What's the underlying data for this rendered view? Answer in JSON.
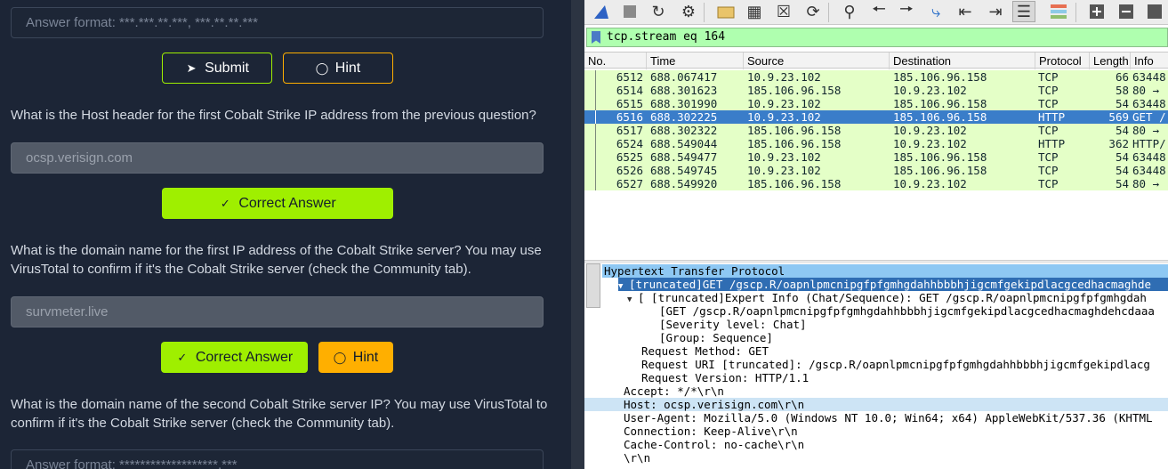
{
  "quiz": {
    "q0_placeholder": "Answer format: ***.***.**.***, ***.**.**.***",
    "submit_label": "Submit",
    "hint_label": "Hint",
    "q1_text": "What is the Host header for the first Cobalt Strike IP address from the previous question?",
    "q1_answer": "ocsp.verisign.com",
    "correct_label": "Correct Answer",
    "q2_text": "What is the domain name for the first IP address of the Cobalt Strike server? You may use VirusTotal to confirm if it's the Cobalt Strike server (check the Community tab).",
    "q2_answer": "survmeter.live",
    "q3_text": "What is the domain name of the second Cobalt Strike server IP?  You may use VirusTotal to confirm if it's the Cobalt Strike server (check the Community tab).",
    "q3_placeholder": "Answer format: *******************.***",
    "colors": {
      "accent_green": "#9fef00",
      "accent_orange": "#ffaf00",
      "background": "#1c2536"
    }
  },
  "wireshark": {
    "display_filter": "tcp.stream eq 164",
    "columns": [
      "No.",
      "Time",
      "Source",
      "Destination",
      "Protocol",
      "Length",
      "Info"
    ],
    "packets": [
      {
        "no": "6512",
        "time": "688.067417",
        "src": "10.9.23.102",
        "dst": "185.106.96.158",
        "proto": "TCP",
        "len": "66",
        "info": "63448"
      },
      {
        "no": "6514",
        "time": "688.301623",
        "src": "185.106.96.158",
        "dst": "10.9.23.102",
        "proto": "TCP",
        "len": "58",
        "info": "80 →"
      },
      {
        "no": "6515",
        "time": "688.301990",
        "src": "10.9.23.102",
        "dst": "185.106.96.158",
        "proto": "TCP",
        "len": "54",
        "info": "63448"
      },
      {
        "no": "6516",
        "time": "688.302225",
        "src": "10.9.23.102",
        "dst": "185.106.96.158",
        "proto": "HTTP",
        "len": "569",
        "info": "GET /"
      },
      {
        "no": "6517",
        "time": "688.302322",
        "src": "185.106.96.158",
        "dst": "10.9.23.102",
        "proto": "TCP",
        "len": "54",
        "info": "80 →"
      },
      {
        "no": "6524",
        "time": "688.549044",
        "src": "185.106.96.158",
        "dst": "10.9.23.102",
        "proto": "HTTP",
        "len": "362",
        "info": "HTTP/"
      },
      {
        "no": "6525",
        "time": "688.549477",
        "src": "10.9.23.102",
        "dst": "185.106.96.158",
        "proto": "TCP",
        "len": "54",
        "info": "63448"
      },
      {
        "no": "6526",
        "time": "688.549745",
        "src": "10.9.23.102",
        "dst": "185.106.96.158",
        "proto": "TCP",
        "len": "54",
        "info": "63448"
      },
      {
        "no": "6527",
        "time": "688.549920",
        "src": "185.106.96.158",
        "dst": "10.9.23.102",
        "proto": "TCP",
        "len": "54",
        "info": "80 →"
      }
    ],
    "details": [
      "Hypertext Transfer Protocol",
      "[truncated]GET /gscp.R/oapnlpmcnipgfpfgmhgdahhbbbhjigcmfgekipdlacgcedhacmaghde",
      "[ [truncated]Expert Info (Chat/Sequence): GET /gscp.R/oapnlpmcnipgfpfgmhgdah",
      "[GET /gscp.R/oapnlpmcnipgfpfgmhgdahhbbbhjigcmfgekipdlacgcedhacmaghdehcdaaa",
      "[Severity level: Chat]",
      "[Group: Sequence]",
      "Request Method: GET",
      "Request URI [truncated]: /gscp.R/oapnlpmcnipgfpfgmhgdahhbbbhjigcmfgekipdlacg",
      "Request Version: HTTP/1.1",
      "Accept: */*\\r\\n",
      "Host: ocsp.verisign.com\\r\\n",
      "User-Agent: Mozilla/5.0 (Windows NT 10.0; Win64; x64) AppleWebKit/537.36 (KHTML",
      "Connection: Keep-Alive\\r\\n",
      "Cache-Control: no-cache\\r\\n",
      "\\r\\n"
    ]
  }
}
